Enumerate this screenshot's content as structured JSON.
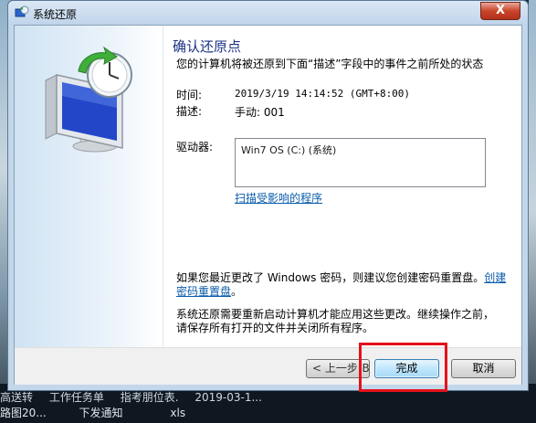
{
  "window": {
    "title": "系统还原",
    "close_glyph": "X"
  },
  "page": {
    "heading": "确认还原点",
    "subheading": "您的计算机将被还原到下面“描述”字段中的事件之前所处的状态",
    "time_label": "时间:",
    "time_value": "2019/3/19 14:14:52 (GMT+8:00)",
    "desc_label": "描述:",
    "desc_value": "手动: 001",
    "drives_label": "驱动器:",
    "drives": [
      "Win7 OS (C:) (系统)"
    ],
    "scan_link": "扫描受影响的程序",
    "password_note": "如果您最近更改了 Windows 密码，则建议您创建密码重置盘。",
    "password_link_part1": "创建",
    "password_link_part2": "密码重置盘",
    "password_link_suffix": "。",
    "restart_note_line1": "系统还原需要重新启动计算机才能应用这些更改。继续操作之前，",
    "restart_note_line2": "请保存所有打开的文件并关闭所有程序。"
  },
  "buttons": {
    "back": "< 上一步(B)",
    "finish": "完成",
    "cancel": "取消"
  },
  "taskbar": {
    "row1": [
      "高送转",
      "工作任务单",
      "指考朋位表.",
      "2019-03-1..."
    ],
    "row2": [
      "路图20...",
      "下发通知",
      "xls"
    ]
  },
  "colors": {
    "heading": "#1e3287",
    "link": "#0b5cab",
    "highlight": "#e3121b"
  }
}
